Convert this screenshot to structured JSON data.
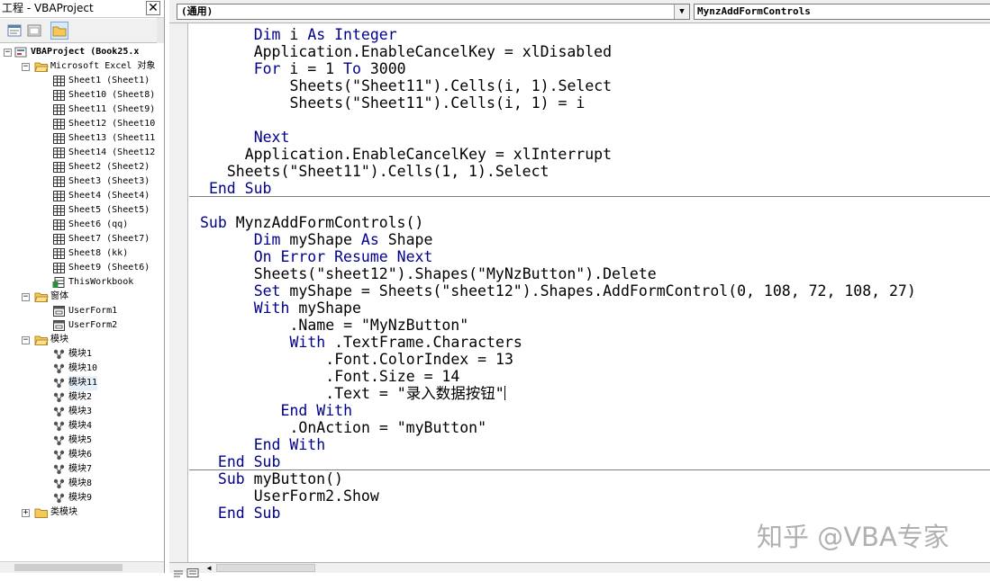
{
  "project_window": {
    "title": "工程 - VBAProject",
    "close_glyph": "✕",
    "toolbar": [
      "view-code-icon",
      "view-object-icon",
      "toggle-folders-icon"
    ],
    "tree": [
      {
        "label": "VBAProject (Book25.x",
        "level": 0,
        "expander": "−",
        "icon": "vba-project-icon",
        "bold": true
      },
      {
        "label": "Microsoft Excel 对象",
        "level": 1,
        "expander": "−",
        "icon": "folder-open-icon"
      },
      {
        "label": "Sheet1 (Sheet1)",
        "level": 2,
        "icon": "sheet-icon"
      },
      {
        "label": "Sheet10 (Sheet8)",
        "level": 2,
        "icon": "sheet-icon"
      },
      {
        "label": "Sheet11 (Sheet9)",
        "level": 2,
        "icon": "sheet-icon"
      },
      {
        "label": "Sheet12 (Sheet10",
        "level": 2,
        "icon": "sheet-icon"
      },
      {
        "label": "Sheet13 (Sheet11",
        "level": 2,
        "icon": "sheet-icon"
      },
      {
        "label": "Sheet14 (Sheet12",
        "level": 2,
        "icon": "sheet-icon"
      },
      {
        "label": "Sheet2 (Sheet2)",
        "level": 2,
        "icon": "sheet-icon"
      },
      {
        "label": "Sheet3 (Sheet3)",
        "level": 2,
        "icon": "sheet-icon"
      },
      {
        "label": "Sheet4 (Sheet4)",
        "level": 2,
        "icon": "sheet-icon"
      },
      {
        "label": "Sheet5 (Sheet5)",
        "level": 2,
        "icon": "sheet-icon"
      },
      {
        "label": "Sheet6 (qq)",
        "level": 2,
        "icon": "sheet-icon"
      },
      {
        "label": "Sheet7 (Sheet7)",
        "level": 2,
        "icon": "sheet-icon"
      },
      {
        "label": "Sheet8 (kk)",
        "level": 2,
        "icon": "sheet-icon"
      },
      {
        "label": "Sheet9 (Sheet6)",
        "level": 2,
        "icon": "sheet-icon"
      },
      {
        "label": "ThisWorkbook",
        "level": 2,
        "icon": "workbook-icon"
      },
      {
        "label": "窗体",
        "level": 1,
        "expander": "−",
        "icon": "folder-open-icon"
      },
      {
        "label": "UserForm1",
        "level": 2,
        "icon": "userform-icon"
      },
      {
        "label": "UserForm2",
        "level": 2,
        "icon": "userform-icon"
      },
      {
        "label": "模块",
        "level": 1,
        "expander": "−",
        "icon": "folder-open-icon"
      },
      {
        "label": "模块1",
        "level": 2,
        "icon": "module-icon"
      },
      {
        "label": "模块10",
        "level": 2,
        "icon": "module-icon"
      },
      {
        "label": "模块11",
        "level": 2,
        "icon": "module-icon",
        "selected": true
      },
      {
        "label": "模块2",
        "level": 2,
        "icon": "module-icon"
      },
      {
        "label": "模块3",
        "level": 2,
        "icon": "module-icon"
      },
      {
        "label": "模块4",
        "level": 2,
        "icon": "module-icon"
      },
      {
        "label": "模块5",
        "level": 2,
        "icon": "module-icon"
      },
      {
        "label": "模块6",
        "level": 2,
        "icon": "module-icon"
      },
      {
        "label": "模块7",
        "level": 2,
        "icon": "module-icon"
      },
      {
        "label": "模块8",
        "level": 2,
        "icon": "module-icon"
      },
      {
        "label": "模块9",
        "level": 2,
        "icon": "module-icon"
      },
      {
        "label": "类模块",
        "level": 1,
        "expander": "+",
        "icon": "folder-closed-icon"
      }
    ]
  },
  "code_window": {
    "object_combo": "(通用)",
    "procedure_combo": "MynzAddFormControls",
    "lines": [
      {
        "indent": 6,
        "parts": [
          {
            "t": "Dim",
            "k": true
          },
          {
            "t": " i "
          },
          {
            "t": "As",
            "k": true
          },
          {
            "t": " "
          },
          {
            "t": "Integer",
            "k": true
          }
        ]
      },
      {
        "indent": 6,
        "parts": [
          {
            "t": "Application.EnableCancelKey = xlDisabled"
          }
        ]
      },
      {
        "indent": 6,
        "parts": [
          {
            "t": "For",
            "k": true
          },
          {
            "t": " i = 1 "
          },
          {
            "t": "To",
            "k": true
          },
          {
            "t": " 3000"
          }
        ]
      },
      {
        "indent": 10,
        "parts": [
          {
            "t": "Sheets(\"Sheet11\").Cells(i, 1).Select"
          }
        ]
      },
      {
        "indent": 10,
        "parts": [
          {
            "t": "Sheets(\"Sheet11\").Cells(i, 1) = i"
          }
        ]
      },
      {
        "indent": 0,
        "parts": []
      },
      {
        "indent": 6,
        "parts": [
          {
            "t": "Next",
            "k": true
          }
        ]
      },
      {
        "indent": 5,
        "parts": [
          {
            "t": "Application.EnableCancelKey = xlInterrupt"
          }
        ]
      },
      {
        "indent": 3,
        "parts": [
          {
            "t": "Sheets(\"Sheet11\").Cells(1, 1).Select"
          }
        ]
      },
      {
        "indent": 1,
        "parts": [
          {
            "t": "End Sub",
            "k": true
          }
        ],
        "sep_after": true
      },
      {
        "indent": 0,
        "parts": []
      },
      {
        "indent": 0,
        "parts": [
          {
            "t": "Sub",
            "k": true
          },
          {
            "t": " MynzAddFormControls()"
          }
        ]
      },
      {
        "indent": 6,
        "parts": [
          {
            "t": "Dim",
            "k": true
          },
          {
            "t": " myShape "
          },
          {
            "t": "As",
            "k": true
          },
          {
            "t": " Shape"
          }
        ]
      },
      {
        "indent": 6,
        "parts": [
          {
            "t": "On Error Resume Next",
            "k": true
          }
        ]
      },
      {
        "indent": 6,
        "parts": [
          {
            "t": "Sheets(\"sheet12\").Shapes(\"MyNzButton\").Delete"
          }
        ]
      },
      {
        "indent": 6,
        "parts": [
          {
            "t": "Set",
            "k": true
          },
          {
            "t": " myShape = Sheets(\"sheet12\").Shapes.AddFormControl(0, 108, 72, 108, 27)"
          }
        ]
      },
      {
        "indent": 6,
        "parts": [
          {
            "t": "With",
            "k": true
          },
          {
            "t": " myShape"
          }
        ]
      },
      {
        "indent": 10,
        "parts": [
          {
            "t": ".Name = \"MyNzButton\""
          }
        ]
      },
      {
        "indent": 10,
        "parts": [
          {
            "t": "With",
            "k": true
          },
          {
            "t": " .TextFrame.Characters"
          }
        ]
      },
      {
        "indent": 14,
        "parts": [
          {
            "t": ".Font.ColorIndex = 13"
          }
        ]
      },
      {
        "indent": 14,
        "parts": [
          {
            "t": ".Font.Size = 14"
          }
        ]
      },
      {
        "indent": 14,
        "parts": [
          {
            "t": ".Text = \"录入数据按钮\""
          }
        ],
        "caret": true
      },
      {
        "indent": 9,
        "parts": [
          {
            "t": "End With",
            "k": true
          }
        ]
      },
      {
        "indent": 10,
        "parts": [
          {
            "t": ".OnAction = \"myButton\""
          }
        ]
      },
      {
        "indent": 6,
        "parts": [
          {
            "t": "End With",
            "k": true
          }
        ]
      },
      {
        "indent": 2,
        "parts": [
          {
            "t": "End Sub",
            "k": true
          }
        ],
        "sep_after": true
      },
      {
        "indent": 2,
        "parts": [
          {
            "t": "Sub",
            "k": true
          },
          {
            "t": " myButton()"
          }
        ]
      },
      {
        "indent": 6,
        "parts": [
          {
            "t": "UserForm2.Show"
          }
        ]
      },
      {
        "indent": 2,
        "parts": [
          {
            "t": "End Sub",
            "k": true
          }
        ]
      }
    ]
  },
  "watermark": "知乎 @VBA专家",
  "colors": {
    "keyword": "#00008b",
    "text": "#000000",
    "selection": "#e5f0fb"
  }
}
